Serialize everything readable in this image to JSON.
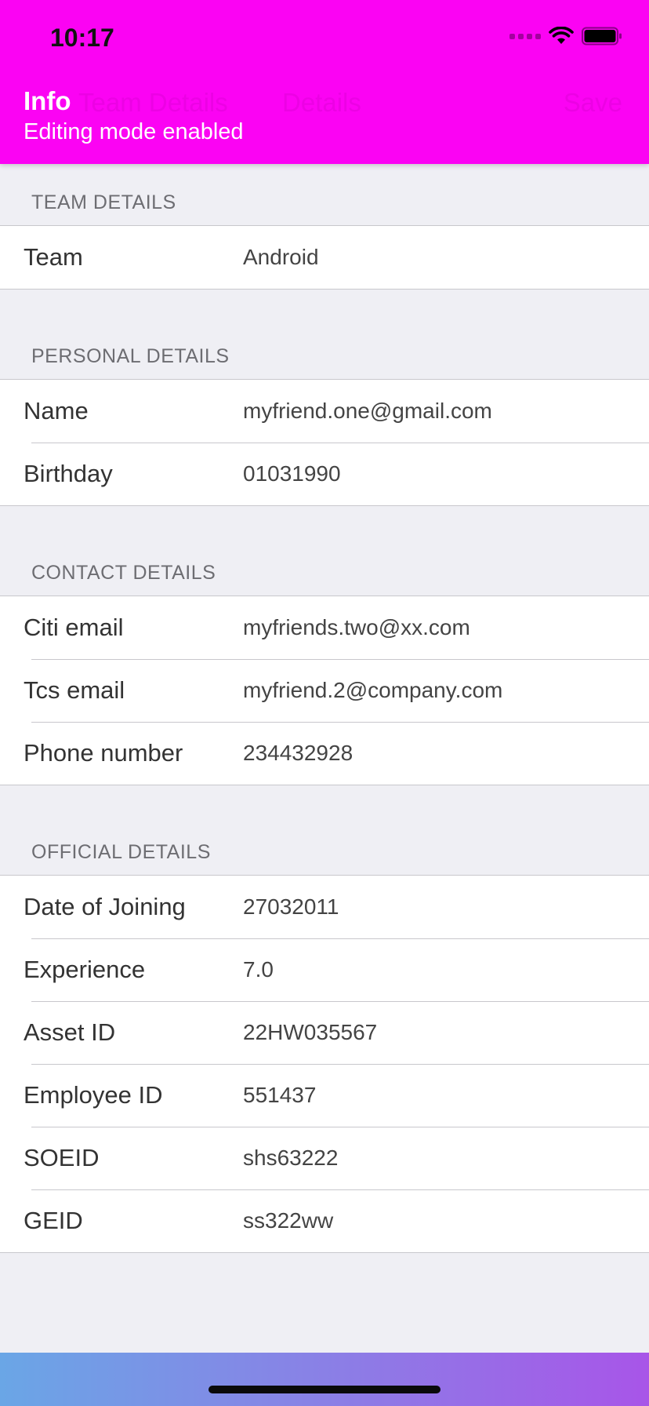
{
  "status_bar": {
    "time": "10:17"
  },
  "nav": {
    "ghost_left": "Team Details",
    "ghost_center": "Details",
    "ghost_right": "Save"
  },
  "header": {
    "title": "Info",
    "subtitle": "Editing mode enabled"
  },
  "colors": {
    "header_bg": "#fb03f3",
    "page_bg": "#efeff4",
    "bottom_gradient_start": "#6aa6e6",
    "bottom_gradient_end": "#a855e8"
  },
  "sections": [
    {
      "title": "TEAM DETAILS",
      "rows": [
        {
          "label": "Team",
          "value": "Android"
        }
      ]
    },
    {
      "title": "PERSONAL DETAILS",
      "rows": [
        {
          "label": "Name",
          "value": "myfriend.one@gmail.com"
        },
        {
          "label": "Birthday",
          "value": "01031990"
        }
      ]
    },
    {
      "title": "CONTACT DETAILS",
      "rows": [
        {
          "label": "Citi email",
          "value": "myfriends.two@xx.com"
        },
        {
          "label": "Tcs email",
          "value": "myfriend.2@company.com"
        },
        {
          "label": "Phone number",
          "value": "234432928"
        }
      ]
    },
    {
      "title": "OFFICIAL DETAILS",
      "rows": [
        {
          "label": "Date of Joining",
          "value": "27032011"
        },
        {
          "label": "Experience",
          "value": "7.0"
        },
        {
          "label": "Asset ID",
          "value": "22HW035567"
        },
        {
          "label": "Employee ID",
          "value": "551437"
        },
        {
          "label": "SOEID",
          "value": "shs63222"
        },
        {
          "label": "GEID",
          "value": "ss322ww"
        }
      ]
    }
  ]
}
